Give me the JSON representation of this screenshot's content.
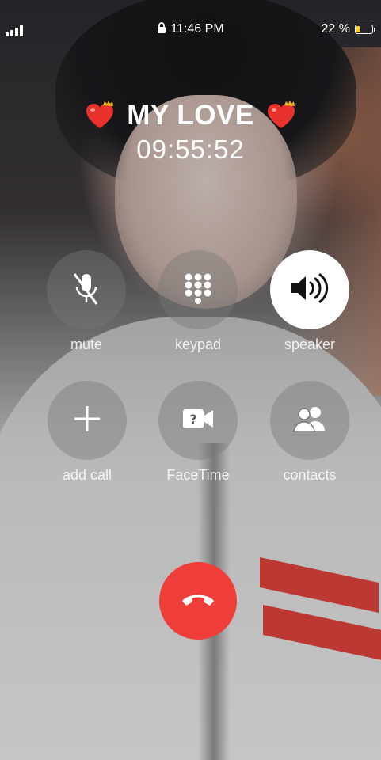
{
  "status_bar": {
    "time": "11:46 PM",
    "battery_percent_text": "22 %",
    "battery_level": 0.22,
    "battery_color": "#ffd400"
  },
  "call": {
    "contact_name": "MY LOVE",
    "timer": "09:55:52",
    "decor_icon": "heart-crown-icon"
  },
  "controls": [
    {
      "label": "mute",
      "icon": "microphone-slash-icon",
      "active": false
    },
    {
      "label": "keypad",
      "icon": "keypad-icon",
      "active": false
    },
    {
      "label": "speaker",
      "icon": "speaker-icon",
      "active": true
    },
    {
      "label": "add call",
      "icon": "plus-icon",
      "active": false
    },
    {
      "label": "FaceTime",
      "icon": "facetime-icon",
      "active": false
    },
    {
      "label": "contacts",
      "icon": "contacts-icon",
      "active": false
    }
  ],
  "end_call": {
    "icon": "phone-hangup-icon",
    "color": "#ef3d39"
  }
}
